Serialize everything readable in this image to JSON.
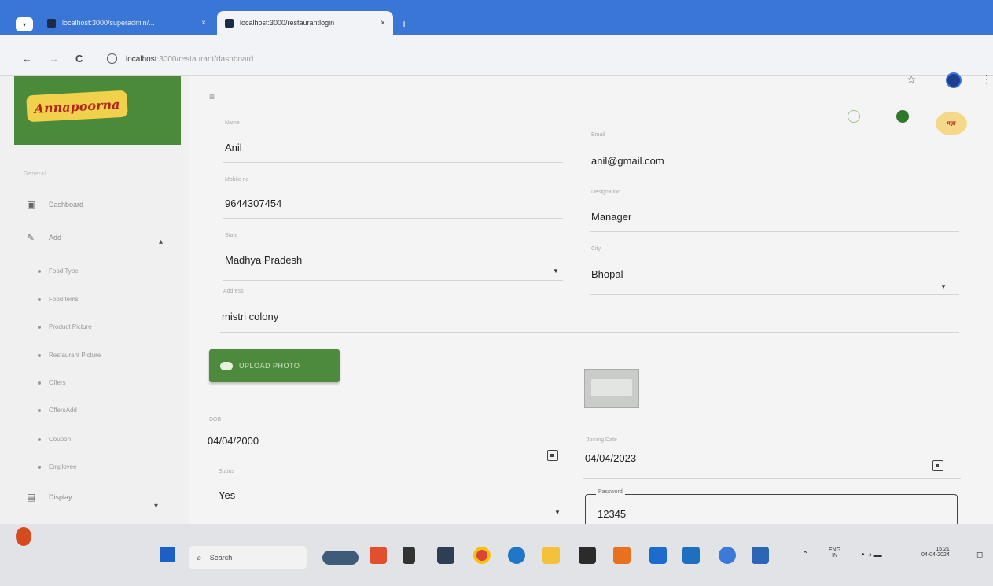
{
  "browser": {
    "tabs": [
      {
        "title": "localhost:3000/superadmin/..."
      },
      {
        "title": "localhost:3000/restaurantlogin"
      }
    ],
    "close_glyph": "×",
    "new_tab_glyph": "+",
    "url_host": "localhost",
    "url_path": ":3000/restaurant/dashboard",
    "back_glyph": "←",
    "forward_glyph": "→",
    "reload_glyph": "C",
    "star_glyph": "☆",
    "menu_glyph": "⋮",
    "win_min": "−",
    "win_max": "▫",
    "win_close": "×"
  },
  "sidebar": {
    "logo_text": "Annapoorna",
    "section_label": "General",
    "items": [
      {
        "label": "Dashboard",
        "icon": "dashboard-icon"
      },
      {
        "label": "Add",
        "icon": "pencil-icon"
      }
    ],
    "sub_items": [
      "Food Type",
      "FoodItems",
      "Product Picture",
      "Restaurant Picture",
      "Offers",
      "OffersAdd",
      "Coupon",
      "Employee"
    ],
    "display_label": "Display"
  },
  "header": {
    "menu_glyph": "≡",
    "avatar_text": "मज़ा"
  },
  "form": {
    "name": {
      "label": "Name",
      "value": "Anil"
    },
    "email": {
      "label": "Email",
      "value": "anil@gmail.com"
    },
    "mobile": {
      "label": "Mobile no",
      "value": "9644307454"
    },
    "designation": {
      "label": "Designation",
      "value": "Manager"
    },
    "state": {
      "label": "State",
      "value": "Madhya Pradesh"
    },
    "city": {
      "label": "City",
      "value": "Bhopal"
    },
    "address": {
      "label": "Address",
      "value": "mistri colony"
    },
    "upload_label": "UPLOAD PHOTO",
    "dob": {
      "label": "DOB",
      "value": "04/04/2000"
    },
    "joining": {
      "label": "Joining Date",
      "value": "04/04/2023"
    },
    "status": {
      "label": "Status",
      "value": "Yes"
    },
    "password": {
      "label": "Password",
      "value": "12345"
    }
  },
  "taskbar": {
    "search_label": "Search",
    "lang": "ENG",
    "lang_sub": "IN",
    "time": "15:21",
    "date": "04-04-2024"
  },
  "colors": {
    "browser_blue": "#3a76d6",
    "brand_green": "#4d8a3d",
    "logo_yellow": "#f1d04b",
    "logo_red": "#b3261e"
  }
}
